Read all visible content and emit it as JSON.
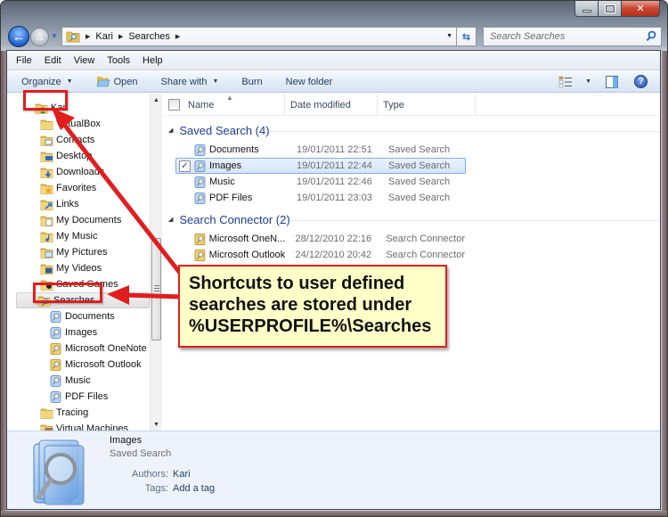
{
  "window": {
    "caption_buttons": {
      "minimize": "minimize",
      "maximize": "maximize",
      "close": "close"
    }
  },
  "address_bar": {
    "breadcrumbs": [
      "Kari",
      "Searches"
    ],
    "search_placeholder": "Search Searches"
  },
  "menu": [
    "File",
    "Edit",
    "View",
    "Tools",
    "Help"
  ],
  "toolbar": {
    "organize": "Organize",
    "open": "Open",
    "share_with": "Share with",
    "burn": "Burn",
    "new_folder": "New folder"
  },
  "navigation": {
    "items": [
      {
        "label": "Kari",
        "icon": "user-folder-icon",
        "level": 0
      },
      {
        "label": "VirtualBox",
        "icon": "folder-icon",
        "level": 1
      },
      {
        "label": "Contacts",
        "icon": "contacts-folder-icon",
        "level": 1
      },
      {
        "label": "Desktop",
        "icon": "desktop-folder-icon",
        "level": 1
      },
      {
        "label": "Downloads",
        "icon": "downloads-folder-icon",
        "level": 1
      },
      {
        "label": "Favorites",
        "icon": "favorites-folder-icon",
        "level": 1
      },
      {
        "label": "Links",
        "icon": "links-folder-icon",
        "level": 1
      },
      {
        "label": "My Documents",
        "icon": "documents-folder-icon",
        "level": 1
      },
      {
        "label": "My Music",
        "icon": "music-folder-icon",
        "level": 1
      },
      {
        "label": "My Pictures",
        "icon": "pictures-folder-icon",
        "level": 1
      },
      {
        "label": "My Videos",
        "icon": "videos-folder-icon",
        "level": 1
      },
      {
        "label": "Saved Games",
        "icon": "saved-games-folder-icon",
        "level": 1
      },
      {
        "label": "Searches",
        "icon": "searches-folder-icon",
        "level": 1,
        "selected": true
      },
      {
        "label": "Documents",
        "icon": "saved-search-icon",
        "level": 2
      },
      {
        "label": "Images",
        "icon": "saved-search-icon",
        "level": 2
      },
      {
        "label": "Microsoft OneNote",
        "icon": "search-connector-icon",
        "level": 2
      },
      {
        "label": "Microsoft Outlook",
        "icon": "search-connector-icon",
        "level": 2
      },
      {
        "label": "Music",
        "icon": "saved-search-icon",
        "level": 2
      },
      {
        "label": "PDF Files",
        "icon": "saved-search-icon",
        "level": 2
      },
      {
        "label": "Tracing",
        "icon": "folder-icon",
        "level": 1
      },
      {
        "label": "Virtual Machines",
        "icon": "virtual-machines-folder-icon",
        "level": 1
      }
    ]
  },
  "file_list": {
    "columns": [
      "Name",
      "Date modified",
      "Type"
    ],
    "groups": [
      {
        "title": "Saved Search (4)",
        "items": [
          {
            "name": "Documents",
            "date": "19/01/2011 22:51",
            "type": "Saved Search",
            "icon": "saved-search-icon"
          },
          {
            "name": "Images",
            "date": "19/01/2011 22:44",
            "type": "Saved Search",
            "icon": "saved-search-icon",
            "selected": true
          },
          {
            "name": "Music",
            "date": "19/01/2011 22:46",
            "type": "Saved Search",
            "icon": "saved-search-icon"
          },
          {
            "name": "PDF Files",
            "date": "19/01/2011 23:03",
            "type": "Saved Search",
            "icon": "saved-search-icon"
          }
        ]
      },
      {
        "title": "Search Connector (2)",
        "items": [
          {
            "name": "Microsoft OneN...",
            "date": "28/12/2010 22:16",
            "type": "Search Connector",
            "icon": "search-connector-icon"
          },
          {
            "name": "Microsoft Outlook",
            "date": "24/12/2010 20:42",
            "type": "Search Connector",
            "icon": "search-connector-icon"
          }
        ]
      }
    ]
  },
  "details": {
    "name": "Images",
    "type": "Saved Search",
    "properties": [
      {
        "key": "Authors:",
        "value": "Kari"
      },
      {
        "key": "Tags:",
        "value": "Add a tag"
      }
    ]
  },
  "annotation": {
    "lines": [
      "Shortcuts to user defined",
      "searches are stored under",
      "%USERPROFILE%\\Searches"
    ],
    "color": "#e01e1e",
    "background": "#ffffc8"
  }
}
